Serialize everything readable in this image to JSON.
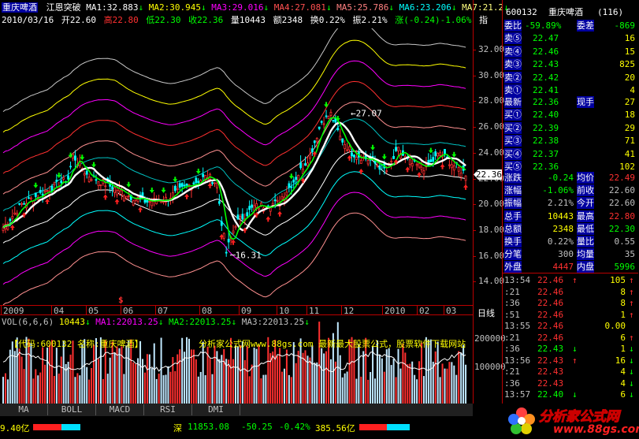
{
  "header": {
    "name": "重庆啤酒",
    "indicator": "江恩突破",
    "ma": [
      {
        "label": "MA1:32.883",
        "arrow": "↓",
        "color": "#ffffff"
      },
      {
        "label": "MA2:30.945",
        "arrow": "↓",
        "color": "#ffff00"
      },
      {
        "label": "MA3:29.016",
        "arrow": "↓",
        "color": "#ff00ff"
      },
      {
        "label": "MA4:27.081",
        "arrow": "↓",
        "color": "#ff5050"
      },
      {
        "label": "MA5:25.786",
        "arrow": "↓",
        "color": "#ff8080"
      },
      {
        "label": "MA6:23.206",
        "arrow": "↓",
        "color": "#00ffff"
      },
      {
        "label": "MA7:21.2",
        "arrow": "↓",
        "color": "#ffff80"
      }
    ],
    "line2": {
      "date": "2010/03/16",
      "open": "开22.60",
      "high": "高22.80",
      "low": "低22.30",
      "close": "收22.36",
      "vol": "量10443",
      "amount": "额2348",
      "turnover": "换0.22%",
      "amplitude": "振2.21%",
      "change": "涨(-0.24)-1.06%",
      "tail": "指"
    }
  },
  "price_axis": [
    "32.00",
    "30.00",
    "28.00",
    "26.00",
    "24.00",
    "22.00",
    "20.00",
    "18.00",
    "16.00",
    "14.00"
  ],
  "current_price_tag": "22.36",
  "annotations": {
    "high": "27.07",
    "low": "16.31",
    "dollar": "$"
  },
  "x_axis": {
    "labels": [
      "2009",
      "04",
      "05",
      "06",
      "07",
      "08",
      "09",
      "10",
      "11",
      "12",
      "2010",
      "02",
      "03"
    ],
    "period": "日线"
  },
  "volume": {
    "header": {
      "title": "VOL(6,6,6)",
      "v1": "10443",
      "ma1": "MA1:22013.25",
      "ma2": "MA2:22013.25",
      "ma3": "MA3:22013.25"
    },
    "axis": [
      "200000",
      "100000"
    ],
    "banner_left": "【代码:600132 名称:重庆啤酒】",
    "banner_right": "分析家公式网www.88gs.com 最新最大股票公式，股票软件下载网站"
  },
  "tabs": [
    "MA",
    "BOLL",
    "MACD",
    "RSI",
    "DMI"
  ],
  "quote": {
    "code": "600132",
    "name": "重庆啤酒",
    "rank": "(116)",
    "ratio_label": "委比",
    "ratio": "-59.89%",
    "diff_label": "委差",
    "diff": "-869",
    "sells": [
      {
        "label": "卖⑤",
        "price": "22.47",
        "vol": "16"
      },
      {
        "label": "卖④",
        "price": "22.46",
        "vol": "15"
      },
      {
        "label": "卖③",
        "price": "22.43",
        "vol": "825"
      },
      {
        "label": "卖②",
        "price": "22.42",
        "vol": "20"
      },
      {
        "label": "卖①",
        "price": "22.41",
        "vol": "4"
      }
    ],
    "latest_label": "最新",
    "latest": "22.36",
    "now_hand_label": "现手",
    "now_hand": "27",
    "buys": [
      {
        "label": "买①",
        "price": "22.40",
        "vol": "18"
      },
      {
        "label": "买②",
        "price": "22.39",
        "vol": "29"
      },
      {
        "label": "买③",
        "price": "22.38",
        "vol": "71"
      },
      {
        "label": "买④",
        "price": "22.37",
        "vol": "41"
      },
      {
        "label": "买⑤",
        "price": "22.36",
        "vol": "102"
      }
    ],
    "stats": [
      {
        "l1": "涨跌",
        "v1": "-0.24",
        "l2": "均价",
        "v2": "22.49"
      },
      {
        "l1": "涨幅",
        "v1": "-1.06%",
        "l2": "前收",
        "v2": "22.60"
      },
      {
        "l1": "振幅",
        "v1": "2.21%",
        "l2": "今开",
        "v2": "22.60"
      },
      {
        "l1": "总手",
        "v1": "10443",
        "l2": "最高",
        "v2": "22.80"
      },
      {
        "l1": "总额",
        "v1": "2348",
        "l2": "最低",
        "v2": "22.30"
      },
      {
        "l1": "换手",
        "v1": "0.22%",
        "l2": "量比",
        "v2": "0.55"
      },
      {
        "l1": "分笔",
        "v1": "300",
        "l2": "均量",
        "v2": "35"
      }
    ],
    "outer_label": "外盘",
    "outer": "4447",
    "inner_label": "内盘",
    "inner": "5996",
    "ticks": [
      {
        "t": "13:54",
        "p": "22.46",
        "a": "↑",
        "v": "105",
        "d": "↑"
      },
      {
        "t": ":21",
        "p": "22.46",
        "a": "",
        "v": "8",
        "d": "↑"
      },
      {
        "t": ":36",
        "p": "22.46",
        "a": "",
        "v": "8",
        "d": "↑"
      },
      {
        "t": ":51",
        "p": "22.46",
        "a": "",
        "v": "1",
        "d": "↑"
      },
      {
        "t": "13:55",
        "p": "22.46",
        "a": "",
        "v": "0.00",
        "d": ""
      },
      {
        "t": ":21",
        "p": "22.46",
        "a": "",
        "v": "6",
        "d": "↑"
      },
      {
        "t": ":36",
        "p": "22.43",
        "a": "↓",
        "v": "1",
        "d": "↓"
      },
      {
        "t": "13:56",
        "p": "22.43",
        "a": "↑",
        "v": "16",
        "d": "↓"
      },
      {
        "t": ":21",
        "p": "22.43",
        "a": "",
        "v": "4",
        "d": "↓"
      },
      {
        "t": ":36",
        "p": "22.43",
        "a": "",
        "v": "4",
        "d": "↓"
      },
      {
        "t": "13:57",
        "p": "22.40",
        "a": "↓",
        "v": "6",
        "d": "↓"
      }
    ]
  },
  "status": {
    "left": "9.40亿",
    "index_label": "深",
    "index": "11853.08",
    "chg": "-50.25",
    "pct": "-0.42%",
    "amt": "385.56亿"
  },
  "watermark": {
    "title": "分析家公式网",
    "url": "www.88gs.com"
  }
}
